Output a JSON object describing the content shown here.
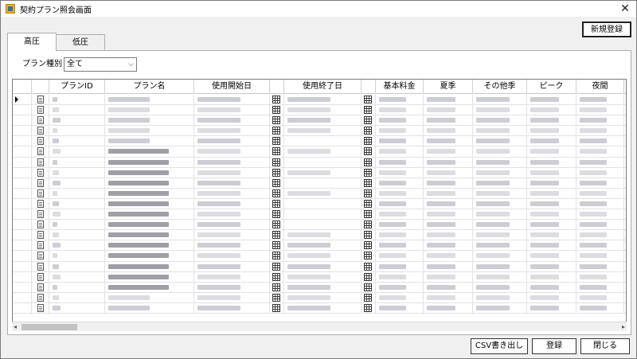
{
  "window": {
    "title": "契約プラン照会画面",
    "close_glyph": "✕"
  },
  "toolbar": {
    "new_label": "新規登録"
  },
  "tabs": [
    {
      "label": "高圧"
    },
    {
      "label": "低圧"
    }
  ],
  "filter": {
    "label": "プラン種別",
    "selected": "全て",
    "arrow": "⌵"
  },
  "table": {
    "headers": [
      "",
      "",
      "プランID",
      "プラン名",
      "使用開始日",
      "",
      "使用終了日",
      "",
      "基本料金",
      "夏季",
      "その他季",
      "ピーク",
      "夜間"
    ],
    "row_count": 21
  },
  "footer": {
    "csv_label": "CSV書き出し",
    "register_label": "登録",
    "close_label": "閉じる"
  },
  "scrollbar": {
    "left_arrow": "◂",
    "right_arrow": "▸"
  }
}
